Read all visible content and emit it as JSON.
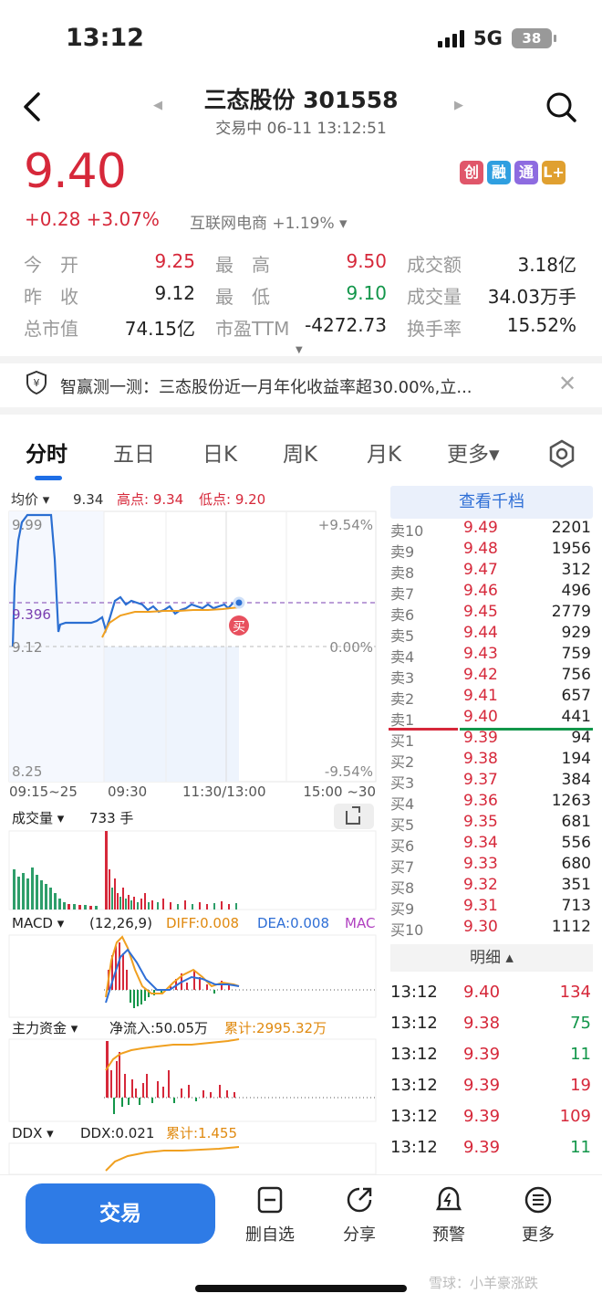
{
  "status": {
    "time": "13:12",
    "network": "5G",
    "battery": "38"
  },
  "header": {
    "title": "三态股份 301558",
    "subtitle": "交易中 06-11 13:12:51"
  },
  "quote": {
    "price": "9.40",
    "change": "+0.28 +3.07%",
    "sector": "互联网电商 +1.19% ▾",
    "tags": [
      {
        "label": "创",
        "color": "#e0566a"
      },
      {
        "label": "融",
        "color": "#2f9fe0"
      },
      {
        "label": "通",
        "color": "#8d6be0"
      },
      {
        "label": "L+",
        "color": "#e0a030"
      }
    ]
  },
  "stats": [
    [
      {
        "label": "今　开",
        "value": "9.25",
        "tone": "red"
      },
      {
        "label": "最　高",
        "value": "9.50",
        "tone": "red"
      },
      {
        "label": "成交额",
        "value": "3.18亿",
        "tone": "dark"
      }
    ],
    [
      {
        "label": "昨　收",
        "value": "9.12",
        "tone": "dark"
      },
      {
        "label": "最　低",
        "value": "9.10",
        "tone": "green"
      },
      {
        "label": "成交量",
        "value": "34.03万手",
        "tone": "dark"
      }
    ],
    [
      {
        "label": "总市值",
        "value": "74.15亿",
        "tone": "dark"
      },
      {
        "label": "市盈TTM",
        "value": "-4272.73",
        "tone": "dark"
      },
      {
        "label": "换手率",
        "value": "15.52%",
        "tone": "dark"
      }
    ]
  ],
  "banner": {
    "text": "智赢测一测：三态股份近一月年化收益率超30.00%,立..."
  },
  "tabs": [
    "分时",
    "五日",
    "日K",
    "周K",
    "月K",
    "更多▾"
  ],
  "chart": {
    "legend_label": "均价 ▾",
    "legend_value": "9.34",
    "legend_high": "高点: 9.34",
    "legend_low": "低点: 9.20",
    "y_top": "9.99",
    "y_avg": "9.396",
    "y_base": "9.12",
    "y_bottom": "8.25",
    "pct_top": "+9.54%",
    "pct_zero": "0.00%",
    "pct_bottom": "-9.54%",
    "x_labels": [
      "09:15~25",
      "09:30",
      "11:30/13:00",
      "15:00 ~30"
    ],
    "buy_marker": "买",
    "volume_label": "成交量 ▾",
    "volume_value": "733 手",
    "macd_label": "MACD ▾",
    "macd_params": "(12,26,9)",
    "macd_diff": "DIFF:0.008",
    "macd_dea": "DEA:0.008",
    "macd_mac": "MAC",
    "flow_label": "主力资金 ▾",
    "flow_net": "净流入:50.05万",
    "flow_total": "累计:2995.32万",
    "ddx_label": "DDX ▾",
    "ddx_value": "DDX:0.021",
    "ddx_total": "累计:1.455"
  },
  "orderbook": {
    "header": "查看千档",
    "asks": [
      {
        "label": "卖10",
        "price": "9.49",
        "vol": "2201"
      },
      {
        "label": "卖9",
        "price": "9.48",
        "vol": "1956"
      },
      {
        "label": "卖8",
        "price": "9.47",
        "vol": "312"
      },
      {
        "label": "卖7",
        "price": "9.46",
        "vol": "496"
      },
      {
        "label": "卖6",
        "price": "9.45",
        "vol": "2779"
      },
      {
        "label": "卖5",
        "price": "9.44",
        "vol": "929"
      },
      {
        "label": "卖4",
        "price": "9.43",
        "vol": "759"
      },
      {
        "label": "卖3",
        "price": "9.42",
        "vol": "756"
      },
      {
        "label": "卖2",
        "price": "9.41",
        "vol": "657"
      },
      {
        "label": "卖1",
        "price": "9.40",
        "vol": "441"
      }
    ],
    "bids": [
      {
        "label": "买1",
        "price": "9.39",
        "vol": "94"
      },
      {
        "label": "买2",
        "price": "9.38",
        "vol": "194"
      },
      {
        "label": "买3",
        "price": "9.37",
        "vol": "384"
      },
      {
        "label": "买4",
        "price": "9.36",
        "vol": "1263"
      },
      {
        "label": "买5",
        "price": "9.35",
        "vol": "681"
      },
      {
        "label": "买6",
        "price": "9.34",
        "vol": "556"
      },
      {
        "label": "买7",
        "price": "9.33",
        "vol": "680"
      },
      {
        "label": "买8",
        "price": "9.32",
        "vol": "351"
      },
      {
        "label": "买9",
        "price": "9.31",
        "vol": "713"
      },
      {
        "label": "买10",
        "price": "9.30",
        "vol": "1112"
      }
    ],
    "detail_header": "明细 ▴",
    "trades": [
      {
        "time": "13:12",
        "price": "9.40",
        "vol": "134",
        "tone": "red"
      },
      {
        "time": "13:12",
        "price": "9.38",
        "vol": "75",
        "tone": "green"
      },
      {
        "time": "13:12",
        "price": "9.39",
        "vol": "11",
        "tone": "green"
      },
      {
        "time": "13:12",
        "price": "9.39",
        "vol": "19",
        "tone": "red"
      },
      {
        "time": "13:12",
        "price": "9.39",
        "vol": "109",
        "tone": "red"
      },
      {
        "time": "13:12",
        "price": "9.39",
        "vol": "11",
        "tone": "green"
      }
    ]
  },
  "bottom": {
    "trade": "交易",
    "items": [
      "删自选",
      "分享",
      "预警",
      "更多"
    ]
  },
  "watermark": "雪球：小羊豪涨跌",
  "colors": {
    "red": "#d6283a",
    "green": "#12964a",
    "accent": "#2e7be6"
  },
  "icons": [
    "back-icon",
    "search-icon",
    "shield-yen-icon",
    "close-icon",
    "settings-icon",
    "rotate-icon",
    "minus-box-icon",
    "share-icon",
    "alert-icon",
    "more-icon"
  ]
}
